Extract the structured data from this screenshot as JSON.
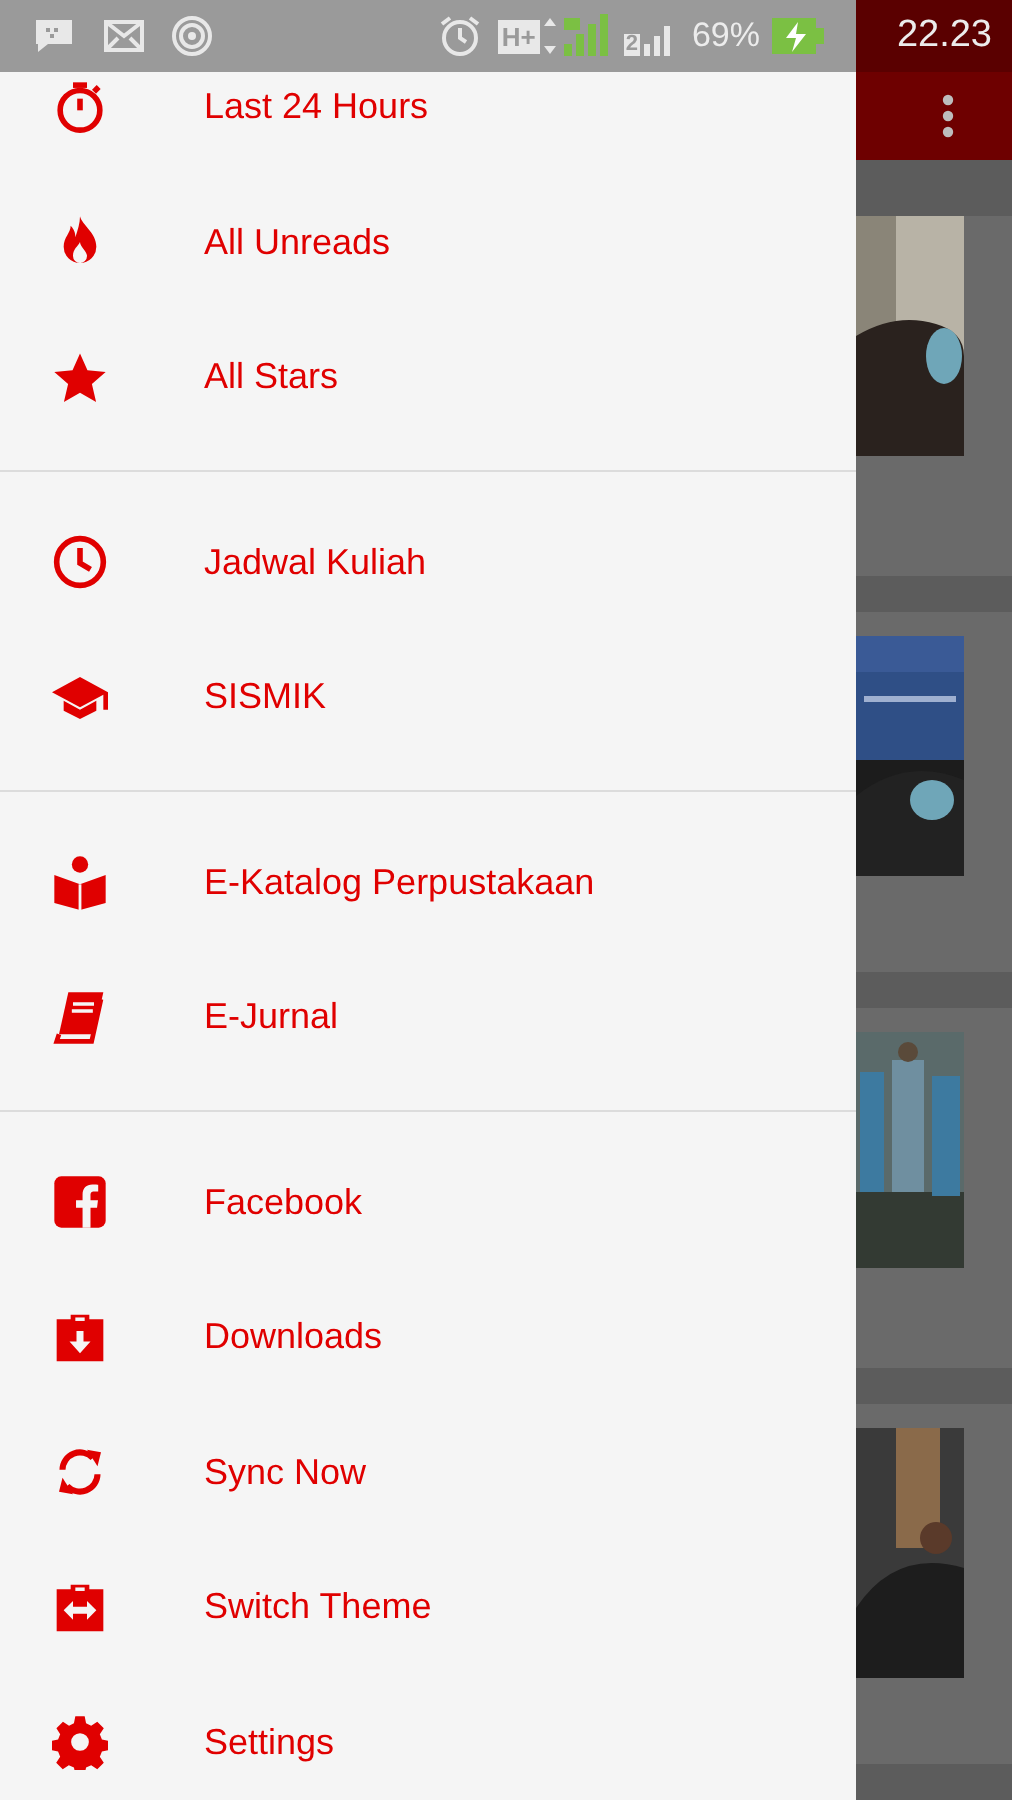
{
  "status_bar": {
    "network": "H+",
    "sim": "2",
    "battery": "69%",
    "time": "22.23"
  },
  "drawer": {
    "sections": [
      {
        "items": [
          {
            "label": "Last 24 Hours"
          },
          {
            "label": "All Unreads"
          },
          {
            "label": "All Stars"
          }
        ]
      },
      {
        "items": [
          {
            "label": "Jadwal Kuliah"
          },
          {
            "label": "SISMIK"
          }
        ]
      },
      {
        "items": [
          {
            "label": "E-Katalog Perpustakaan"
          },
          {
            "label": "E-Jurnal"
          }
        ]
      },
      {
        "items": [
          {
            "label": "Facebook"
          },
          {
            "label": "Downloads"
          },
          {
            "label": "Sync Now"
          },
          {
            "label": "Switch Theme"
          },
          {
            "label": "Settings"
          }
        ]
      }
    ]
  }
}
